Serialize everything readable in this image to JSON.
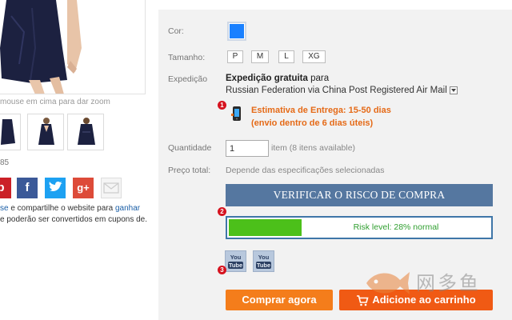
{
  "left": {
    "zoom_hint": "mouse em cima para dar zoom",
    "count": "85",
    "social_icons": [
      "pinterest-icon",
      "facebook-icon",
      "twitter-icon",
      "google-plus-icon",
      "email-icon"
    ],
    "social_glyphs": {
      "facebook": "f",
      "google_plus": "g+"
    },
    "share_text": {
      "line1_link": "se",
      "line1_text": " e compartilhe o website para ",
      "line1_link2": "ganhar",
      "line2": "e poderão ser convertidos em cupons de."
    }
  },
  "form": {
    "color_label": "Cor:",
    "selected_color": "#1a80ff",
    "size_label": "Tamanho:",
    "sizes": [
      "P",
      "M",
      "L",
      "XG"
    ],
    "shipping_label": "Expedição",
    "shipping_free": "Expedição gratuita",
    "shipping_suffix": " para",
    "shipping_route": "Russian Federation via China Post Registered Air Mail",
    "delivery_line1": "Estimativa de Entrega: 15-50 dias",
    "delivery_line2": "(envio dentro de 6 dias úteis)",
    "quantity_label": "Quantidade",
    "quantity_value": "1",
    "quantity_note": "item (8 itens available)",
    "price_label": "Preço total:",
    "price_value": "Depende das especificações selecionadas"
  },
  "markers": [
    "1",
    "2",
    "3"
  ],
  "risk": {
    "verify_button": "VERIFICAR O RISCO DE COMPRA",
    "level_text": "Risk level: 28% normal",
    "level_percent": 28,
    "bar_color": "#4cc01a"
  },
  "youtube": {
    "label_top": "You",
    "label_bottom": "Tube"
  },
  "actions": {
    "buy_now": "Comprar agora",
    "add_to_cart": "Adicione ao carrinho"
  },
  "watermark": {
    "text": "网多鱼"
  },
  "colors": {
    "accent_orange": "#f47d1b",
    "cart_orange": "#f05a14",
    "verify_blue": "#5577a0",
    "estimate_orange": "#e56a17",
    "badge_red": "#d6131f"
  }
}
